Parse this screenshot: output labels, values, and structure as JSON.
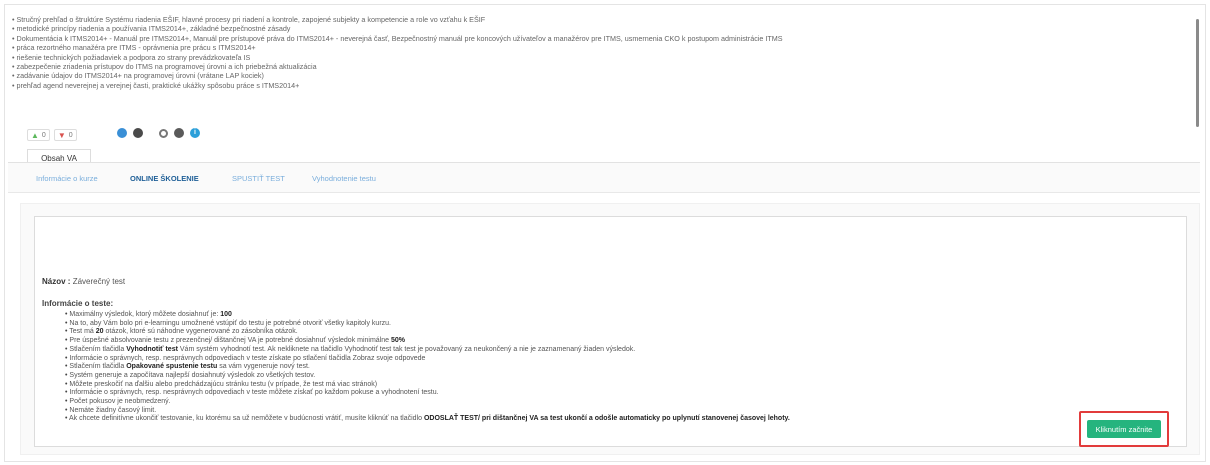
{
  "course": {
    "description_items": [
      "Stručný prehľad o štruktúre Systému riadenia EŠIF, hlavné procesy pri riadení a kontrole, zapojené subjekty a kompetencie a role vo vzťahu k EŠIF",
      "metodické princípy riadenia a používania ITMS2014+, základné bezpečnostné zásady",
      "Dokumentácia k ITMS2014+ - Manuál pre ITMS2014+, Manuál pre prístupové práva do ITMS2014+ - neverejná časť, Bezpečnostný manuál pre koncových užívateľov a manažérov pre ITMS, usmernenia CKO k postupom administrácie ITMS",
      "práca rezortného manažéra pre ITMS - oprávnenia pre prácu s ITMS2014+",
      "riešenie technických požiadaviek a podpora zo strany prevádzkovateľa IS",
      "zabezpečenie zriadenia prístupov do ITMS na programovej úrovni a ich priebežná aktualizácia",
      "zadávanie údajov do ITMS2014+ na programovej úrovni (vrátane LAP kociek)",
      "prehľad agend neverejnej a verejnej časti, praktické ukážky spôsobu práce s ITMS2014+"
    ],
    "likes": "0",
    "dislikes": "0"
  },
  "tabs": {
    "main": "Obsah VA",
    "sub": [
      "Informácie o kurze",
      "ONLINE ŠKOLENIE",
      "SPUSTIŤ TEST",
      "Vyhodnotenie testu"
    ]
  },
  "test": {
    "name_label": "Názov :",
    "name_value": "Záverečný test",
    "info_title": "Informácie o teste:",
    "rules": [
      [
        {
          "t": "Maximálny výsledok, ktorý môžete dosiahnuť je: "
        },
        {
          "t": "100",
          "b": true
        }
      ],
      [
        {
          "t": "Na to, aby Vám bolo pri e-learningu umožnené vstúpiť do testu je potrebné otvoriť všetky kapitoly kurzu."
        }
      ],
      [
        {
          "t": "Test má "
        },
        {
          "t": "20",
          "b": true
        },
        {
          "t": " otázok, ktoré sú náhodne vygenerované zo zásobníka otázok."
        }
      ],
      [
        {
          "t": "Pre úspešné absolvovanie testu z prezenčnej/ dištančnej VA je potrebné dosiahnuť výsledok minimálne "
        },
        {
          "t": "50%",
          "b": true
        }
      ],
      [
        {
          "t": "Stlačením tlačidla "
        },
        {
          "t": "Vyhodnotiť test",
          "b": true
        },
        {
          "t": " Vám systém vyhodnotí test. Ak nekliknete na tlačidlo Vyhodnotiť test tak test je považovaný za neukončený a nie je zaznamenaný žiaden výsledok."
        }
      ],
      [
        {
          "t": "Informácie o správnych, resp. nesprávnych odpovediach v teste získate po stlačení tlačidla Zobraz svoje odpovede"
        }
      ],
      [
        {
          "t": "Stlačením tlačidla "
        },
        {
          "t": "Opakované spustenie testu",
          "b": true
        },
        {
          "t": " sa vám vygeneruje nový test."
        }
      ],
      [
        {
          "t": "Systém generuje a započítava najlepší dosiahnutý výsledok zo všetkých testov."
        }
      ],
      [
        {
          "t": "Môžete preskočiť na ďalšiu alebo predchádzajúcu stránku testu (v prípade, že test má viac stránok)"
        }
      ],
      [
        {
          "t": "Informácie o správnych, resp. nesprávnych odpovediach v teste môžete získať po každom pokuse a vyhodnotení testu."
        }
      ],
      [
        {
          "t": "Počet pokusov je neobmedzený."
        }
      ],
      [
        {
          "t": "Nemáte žiadny časový limit."
        }
      ],
      [
        {
          "t": "Ak chcete definitívne ukončiť testovanie, ku ktorému sa už nemôžete v budúcnosti vrátiť, musíte kliknúť na tlačidlo "
        },
        {
          "t": "ODOSLAŤ TEST/ pri dištančnej VA sa test ukončí a odošle automaticky po uplynutí stanovenej časovej lehoty.",
          "b": true
        }
      ]
    ],
    "start_button": "Kliknutím začnite"
  },
  "icons": [
    "thumbs-up-icon",
    "thumbs-down-icon",
    "user-icon",
    "status-dot-icon",
    "clock-icon",
    "globe-icon",
    "info-icon"
  ],
  "colors": {
    "accent": "#25b47e",
    "highlight": "#e23b3b",
    "active_tab": "#1f5f97",
    "tab_link": "#7aaedc"
  }
}
